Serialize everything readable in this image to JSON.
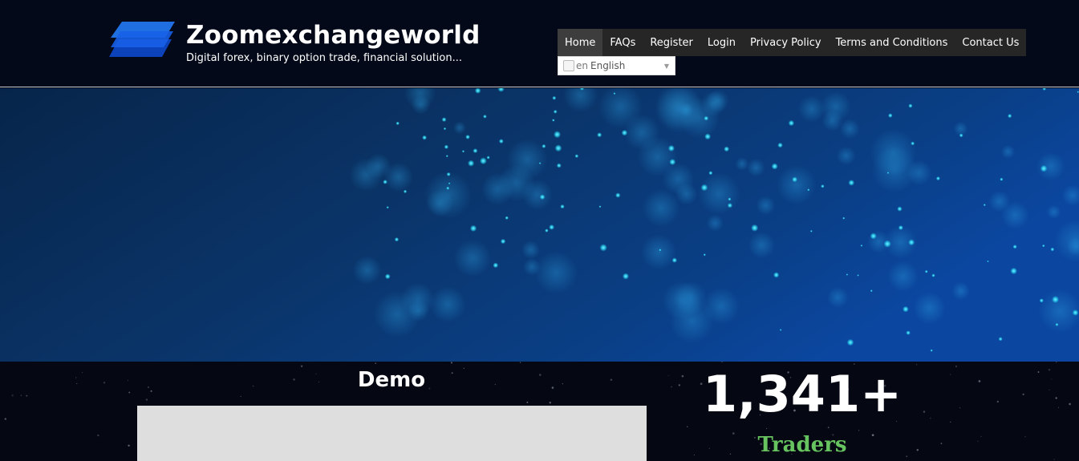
{
  "header": {
    "site_title": "Zoomexchangeworld",
    "tagline": "Digital forex, binary option trade, financial solution...",
    "logo_icon": "stacked-layers-icon"
  },
  "nav": {
    "items": [
      {
        "label": "Home",
        "active": true
      },
      {
        "label": "FAQs"
      },
      {
        "label": "Register"
      },
      {
        "label": "Login"
      },
      {
        "label": "Privacy Policy"
      },
      {
        "label": "Terms and Conditions"
      },
      {
        "label": "Contact Us"
      }
    ]
  },
  "language": {
    "code": "en",
    "selected": "English"
  },
  "demo": {
    "title": "Demo"
  },
  "stats": {
    "number": "1,341+",
    "label": "Traders"
  },
  "colors": {
    "header_bg": "#030918",
    "nav_bg": "#262626",
    "accent_green": "#67c35f",
    "hero_blue": "#0b3f84"
  }
}
